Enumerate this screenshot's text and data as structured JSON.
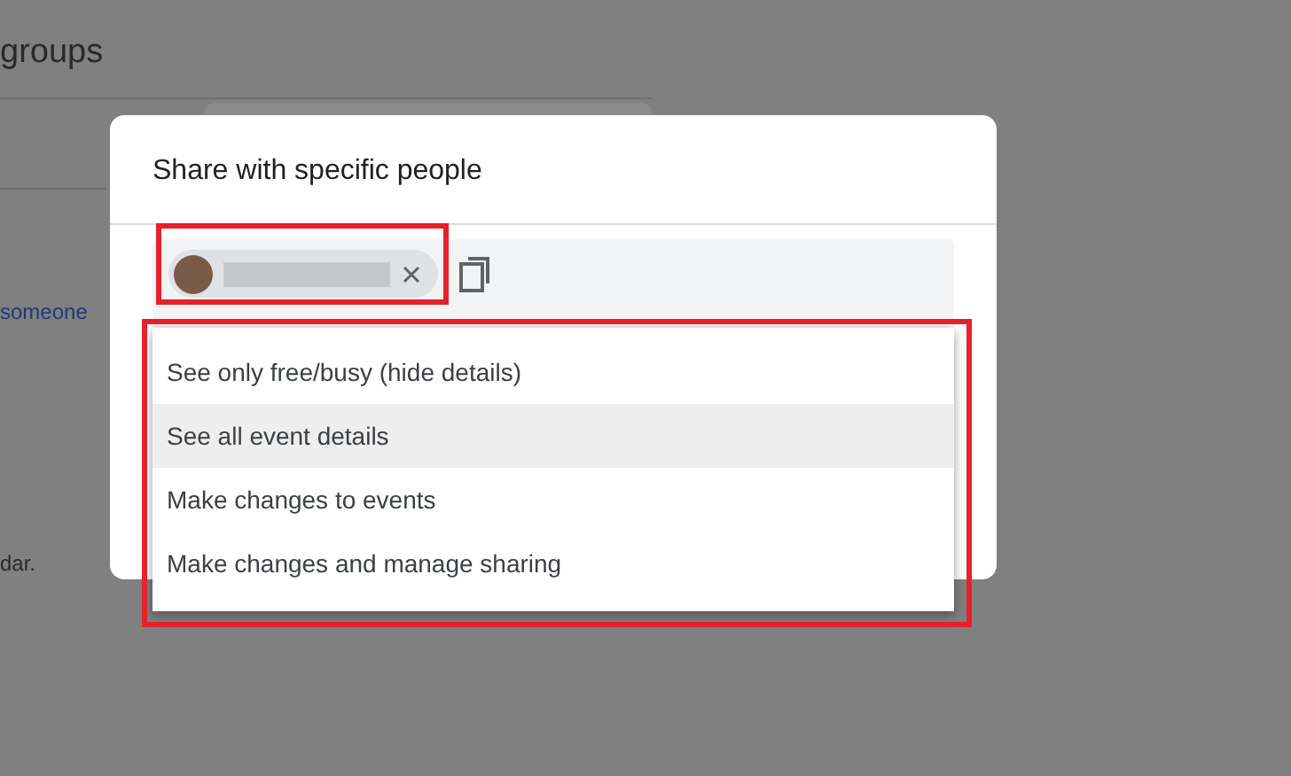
{
  "background_page": {
    "heading": "groups",
    "link": "someone",
    "text": "dar."
  },
  "dialog": {
    "title": "Share with specific people"
  },
  "permission_menu": {
    "items": [
      {
        "label": "See only free/busy (hide details)",
        "selected": false
      },
      {
        "label": "See all event details",
        "selected": true
      },
      {
        "label": "Make changes to events",
        "selected": false
      },
      {
        "label": "Make changes and manage sharing",
        "selected": false
      }
    ]
  }
}
